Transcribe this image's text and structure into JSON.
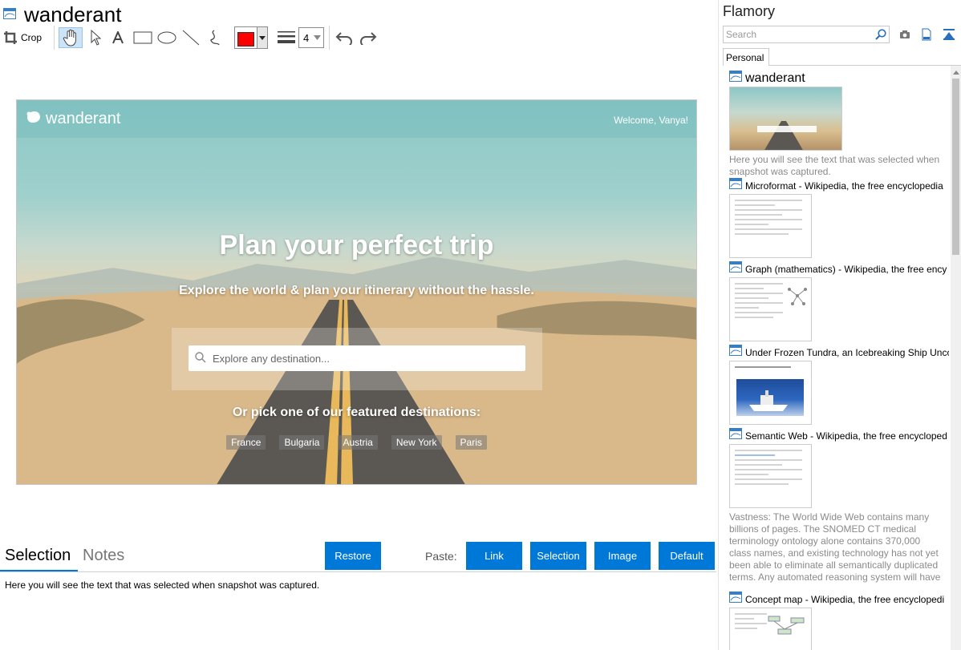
{
  "window": {
    "title": "wanderant"
  },
  "toolbar": {
    "crop_label": "Crop",
    "color_hex": "#ff0000",
    "line_width": "4",
    "icons": [
      "crop-icon",
      "hand-icon",
      "pointer-icon",
      "text-icon",
      "rectangle-icon",
      "ellipse-icon",
      "line-icon",
      "freehand-icon",
      "color-picker",
      "line-width-icon",
      "undo-icon",
      "redo-icon"
    ]
  },
  "snapshot": {
    "logo": "wanderant",
    "welcome": "Welcome, Vanya!",
    "hero_title": "Plan your perfect trip",
    "hero_subtitle": "Explore the world & plan your itinerary without the hassle.",
    "search_placeholder": "Explore any destination...",
    "featured_text": "Or pick one of our featured destinations:",
    "destinations": [
      "France",
      "Bulgaria",
      "Austria",
      "New York",
      "Paris"
    ]
  },
  "bottom": {
    "tabs": {
      "selection": "Selection",
      "notes": "Notes"
    },
    "restore_label": "Restore",
    "paste_label": "Paste:",
    "paste_buttons": {
      "link": "Link",
      "selection": "Selection",
      "image": "Image",
      "default": "Default"
    },
    "selection_text": "Here you will see the text that was selected when snapshot was captured."
  },
  "sidebar": {
    "title": "Flamory",
    "search_placeholder": "Search",
    "tab": "Personal",
    "items": [
      {
        "title": "wanderant",
        "description": "Here you will see the text that was selected when snapshot was captured."
      },
      {
        "title": "Microformat - Wikipedia, the free encyclopedia"
      },
      {
        "title": "Graph (mathematics) - Wikipedia, the free ency"
      },
      {
        "title": "Under Frozen Tundra, an Icebreaking Ship Unco"
      },
      {
        "title": "Semantic Web - Wikipedia, the free encycloped",
        "description": "Vastness: The World Wide Web contains many billions of pages. The SNOMED CT medical terminology ontology alone contains 370,000 class names, and existing technology has not yet been able to eliminate all semantically duplicated terms. Any automated reasoning system will have to deal with truly huge inputs."
      },
      {
        "title": "Concept map - Wikipedia, the free encyclopedi"
      }
    ]
  },
  "colors": {
    "accent": "#0078d7",
    "toolbar_active": "#cde3f7"
  }
}
